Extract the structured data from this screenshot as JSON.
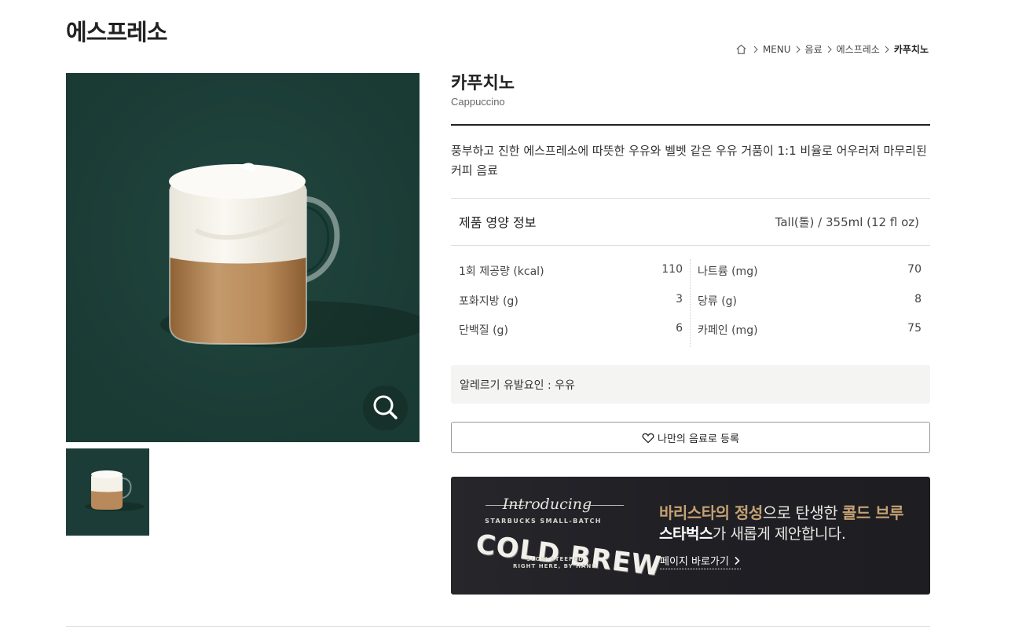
{
  "page": {
    "title": "에스프레소"
  },
  "breadcrumb": {
    "items": [
      "MENU",
      "음료",
      "에스프레소"
    ],
    "current": "카푸치노"
  },
  "product": {
    "name": "카푸치노",
    "english_name": "Cappuccino",
    "description": "풍부하고 진한 에스프레소에 따뜻한 우유와 벨벳 같은 우유 거품이 1:1 비율로 어우러져 마무리된 커피 음료"
  },
  "nutrition": {
    "heading": "제품 영양 정보",
    "size": "Tall(톨) / 355ml (12 fl oz)",
    "left": [
      {
        "label": "1회 제공량 (kcal)",
        "value": "110"
      },
      {
        "label": "포화지방 (g)",
        "value": "3"
      },
      {
        "label": "단백질 (g)",
        "value": "6"
      }
    ],
    "right": [
      {
        "label": "나트륨 (mg)",
        "value": "70"
      },
      {
        "label": "당류 (g)",
        "value": "8"
      },
      {
        "label": "카페인 (mg)",
        "value": "75"
      }
    ]
  },
  "allergy": {
    "text": "알레르기 유발요인 : 우유"
  },
  "favorite_button": {
    "label": "나만의 음료로 등록"
  },
  "banner": {
    "intro": "Introducing",
    "small_title": "STARBUCKS SMALL-BATCH",
    "big_title": "COLD BREW",
    "tagline1": "SLOW-STEEPED",
    "tagline2": "RIGHT HERE, BY HAND",
    "line1_a": "바리스타의 정성",
    "line1_b": "으로 탄생한 ",
    "line1_c": "콜드 브루",
    "line2_a": "스타벅스",
    "line2_b": "가 새롭게 제안합니다.",
    "link": "페이지 바로가기"
  },
  "colors": {
    "image_bg": "#1c3d37",
    "gold": "#c5a173",
    "banner_bg": "#1f1f24"
  }
}
